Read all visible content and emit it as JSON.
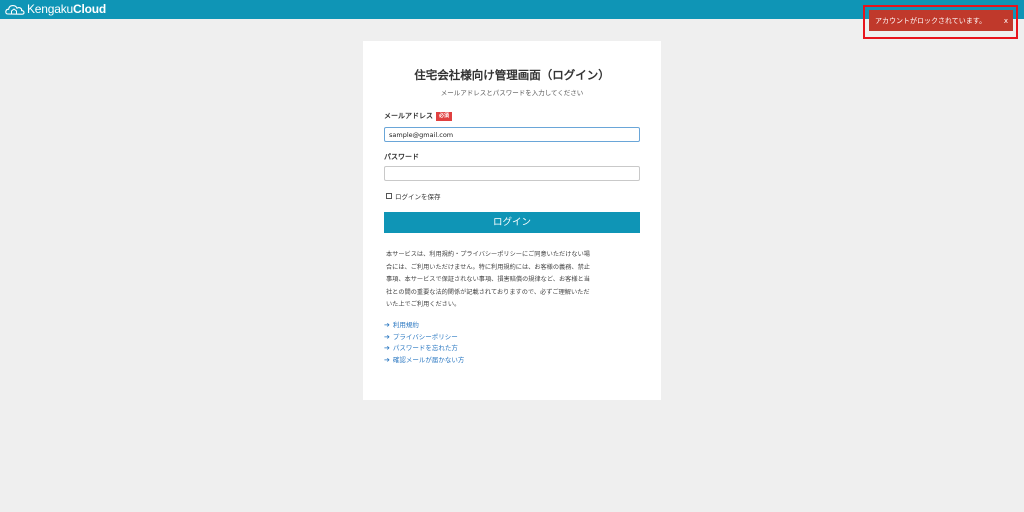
{
  "header": {
    "brand_light": "Kengaku",
    "brand_bold": "Cloud",
    "logo_icon": "house-cloud-icon",
    "background_color": "#0f95b6"
  },
  "toast": {
    "message": "アカウントがロックされています。",
    "close_label": "x",
    "background_color": "#c0392b",
    "highlight_color": "#e8141c"
  },
  "login": {
    "title": "住宅会社様向け管理画面（ログイン）",
    "subtitle": "メールアドレスとパスワードを入力してください",
    "email_label": "メールアドレス",
    "required_badge": "必須",
    "email_value": "sample@gmail.com",
    "password_label": "パスワード",
    "password_value": "",
    "remember_label": "ログインを保存",
    "remember_checked": false,
    "submit_label": "ログイン"
  },
  "notice": {
    "lines": [
      "本サービスは、利用規約・プライバシーポリシーにご同意いただけない場",
      "合には、ご利用いただけません。特に利用規約には、お客様の義務、禁止",
      "事項、本サービスで保証されない事項、損害賠償の規律など、お客様と当",
      "社との間の重要な法的関係が記載されておりますので、必ずご理解いただ",
      "いた上でご利用ください。"
    ]
  },
  "links": [
    {
      "label": "利用規約",
      "icon": "arrow-right-icon"
    },
    {
      "label": "プライバシーポリシー",
      "icon": "arrow-right-icon"
    },
    {
      "label": "パスワードを忘れた方",
      "icon": "arrow-right-icon"
    },
    {
      "label": "確認メールが届かない方",
      "icon": "arrow-right-icon"
    }
  ]
}
